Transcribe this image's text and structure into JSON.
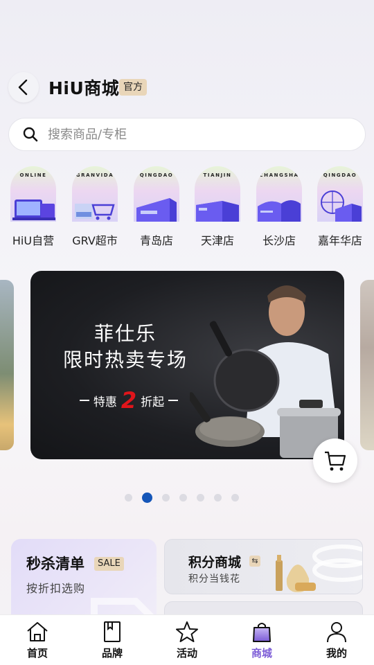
{
  "header": {
    "title": "HiU商城",
    "badge": "官方"
  },
  "search": {
    "placeholder": "搜索商品/专柜"
  },
  "stores": [
    {
      "label": "HiU自营",
      "arc_text": "ONLINE"
    },
    {
      "label": "GRV超市",
      "arc_text": "GRANVIDA"
    },
    {
      "label": "青岛店",
      "arc_text": "QINGDAO"
    },
    {
      "label": "天津店",
      "arc_text": "TIANJIN"
    },
    {
      "label": "长沙店",
      "arc_text": "CHANGSHA"
    },
    {
      "label": "嘉年华店",
      "arc_text": "QINGDAO"
    }
  ],
  "banner": {
    "line1": "菲仕乐",
    "line2": "限时热卖专场",
    "sub_prefix": "特惠",
    "sub_number": "2",
    "sub_suffix": "折起"
  },
  "carousel": {
    "pages": 7,
    "active_index": 1
  },
  "promos": {
    "flash": {
      "title": "秒杀清单",
      "badge": "SALE",
      "subtitle": "按折扣选购"
    },
    "points": {
      "title": "积分商城",
      "subtitle": "积分当钱花"
    }
  },
  "tabs": [
    {
      "label": "首页",
      "icon": "home-icon"
    },
    {
      "label": "品牌",
      "icon": "bookmark-icon"
    },
    {
      "label": "活动",
      "icon": "star-icon"
    },
    {
      "label": "商城",
      "icon": "shopping-bag-icon",
      "active": true
    },
    {
      "label": "我的",
      "icon": "user-icon"
    }
  ],
  "colors": {
    "accent": "#7b5bd6",
    "pager_active": "#1556b8",
    "badge_bg": "#e9d6b9",
    "sale_red": "#e0151b"
  }
}
